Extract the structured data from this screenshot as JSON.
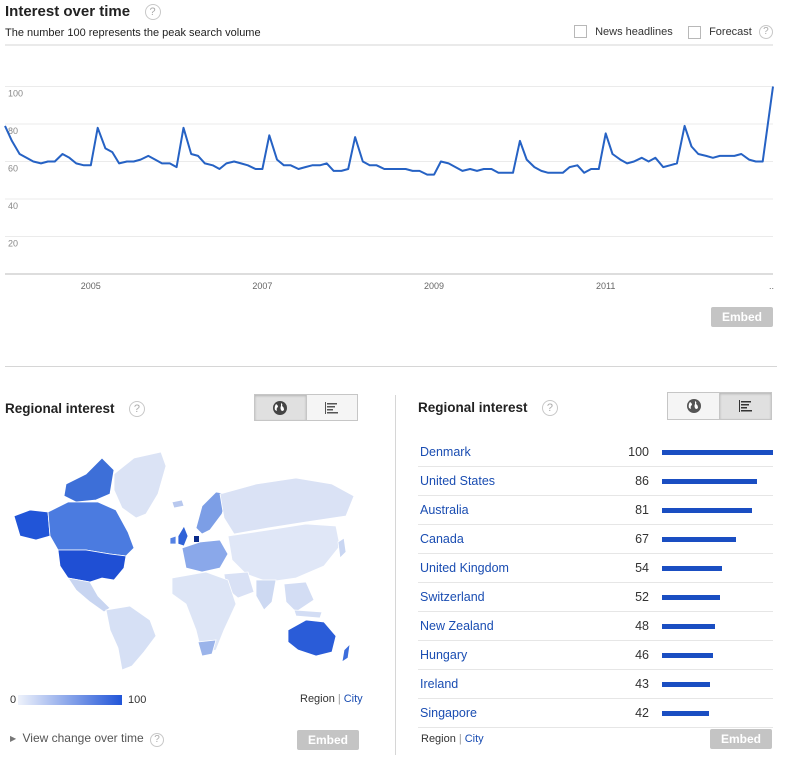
{
  "interest": {
    "title": "Interest over time",
    "subtitle": "The number 100 represents the peak search volume",
    "news_label": "News headlines",
    "forecast_label": "Forecast",
    "help": "?",
    "embed": "Embed"
  },
  "chart_data": {
    "type": "line",
    "title": "Interest over time",
    "y_ticks": [
      "100",
      "80",
      "60",
      "40",
      "20"
    ],
    "x_ticks": [
      "2005",
      "2007",
      "2009",
      "2011"
    ],
    "ellipsis": "..",
    "ylim": [
      0,
      100
    ],
    "xlim": [
      2004.0,
      2012.95
    ],
    "grid": true,
    "color": "#2662c4",
    "series": [
      {
        "values": [
          [
            2004.0,
            79
          ],
          [
            2004.08,
            71
          ],
          [
            2004.17,
            64
          ],
          [
            2004.25,
            62
          ],
          [
            2004.33,
            60
          ],
          [
            2004.42,
            59
          ],
          [
            2004.5,
            60
          ],
          [
            2004.58,
            60
          ],
          [
            2004.67,
            64
          ],
          [
            2004.75,
            62
          ],
          [
            2004.83,
            59
          ],
          [
            2004.92,
            58
          ],
          [
            2005.0,
            58
          ],
          [
            2005.08,
            78
          ],
          [
            2005.17,
            67
          ],
          [
            2005.25,
            65
          ],
          [
            2005.33,
            59
          ],
          [
            2005.42,
            60
          ],
          [
            2005.5,
            60
          ],
          [
            2005.58,
            61
          ],
          [
            2005.67,
            63
          ],
          [
            2005.75,
            61
          ],
          [
            2005.83,
            59
          ],
          [
            2005.92,
            59
          ],
          [
            2006.0,
            57
          ],
          [
            2006.08,
            78
          ],
          [
            2006.17,
            64
          ],
          [
            2006.25,
            63
          ],
          [
            2006.33,
            59
          ],
          [
            2006.42,
            58
          ],
          [
            2006.5,
            56
          ],
          [
            2006.58,
            59
          ],
          [
            2006.67,
            60
          ],
          [
            2006.75,
            59
          ],
          [
            2006.83,
            58
          ],
          [
            2006.92,
            56
          ],
          [
            2007.0,
            56
          ],
          [
            2007.08,
            74
          ],
          [
            2007.17,
            61
          ],
          [
            2007.25,
            58
          ],
          [
            2007.33,
            58
          ],
          [
            2007.42,
            56
          ],
          [
            2007.5,
            57
          ],
          [
            2007.58,
            58
          ],
          [
            2007.67,
            58
          ],
          [
            2007.75,
            59
          ],
          [
            2007.83,
            55
          ],
          [
            2007.92,
            55
          ],
          [
            2008.0,
            56
          ],
          [
            2008.08,
            73
          ],
          [
            2008.17,
            60
          ],
          [
            2008.25,
            58
          ],
          [
            2008.33,
            58
          ],
          [
            2008.42,
            56
          ],
          [
            2008.5,
            56
          ],
          [
            2008.58,
            56
          ],
          [
            2008.67,
            56
          ],
          [
            2008.75,
            55
          ],
          [
            2008.83,
            55
          ],
          [
            2008.92,
            53
          ],
          [
            2009.0,
            53
          ],
          [
            2009.08,
            60
          ],
          [
            2009.17,
            59
          ],
          [
            2009.25,
            57
          ],
          [
            2009.33,
            55
          ],
          [
            2009.42,
            56
          ],
          [
            2009.5,
            55
          ],
          [
            2009.58,
            56
          ],
          [
            2009.67,
            56
          ],
          [
            2009.75,
            54
          ],
          [
            2009.83,
            54
          ],
          [
            2009.92,
            54
          ],
          [
            2010.0,
            71
          ],
          [
            2010.08,
            61
          ],
          [
            2010.17,
            57
          ],
          [
            2010.25,
            55
          ],
          [
            2010.33,
            54
          ],
          [
            2010.42,
            54
          ],
          [
            2010.5,
            54
          ],
          [
            2010.58,
            57
          ],
          [
            2010.67,
            58
          ],
          [
            2010.75,
            54
          ],
          [
            2010.83,
            56
          ],
          [
            2010.92,
            56
          ],
          [
            2011.0,
            75
          ],
          [
            2011.08,
            64
          ],
          [
            2011.17,
            61
          ],
          [
            2011.25,
            59
          ],
          [
            2011.33,
            60
          ],
          [
            2011.42,
            62
          ],
          [
            2011.5,
            60
          ],
          [
            2011.58,
            62
          ],
          [
            2011.67,
            57
          ],
          [
            2011.75,
            58
          ],
          [
            2011.83,
            59
          ],
          [
            2011.92,
            79
          ],
          [
            2012.0,
            68
          ],
          [
            2012.08,
            64
          ],
          [
            2012.17,
            63
          ],
          [
            2012.25,
            62
          ],
          [
            2012.33,
            63
          ],
          [
            2012.42,
            63
          ],
          [
            2012.5,
            63
          ],
          [
            2012.58,
            64
          ],
          [
            2012.67,
            61
          ],
          [
            2012.75,
            60
          ],
          [
            2012.83,
            60
          ],
          [
            2012.95,
            100
          ]
        ]
      }
    ]
  },
  "regional_left": {
    "title": "Regional interest",
    "help": "?",
    "legend_min": "0",
    "legend_max": "100",
    "region_label": "Region",
    "city_label": "City",
    "view_change": "View change over time",
    "embed": "Embed",
    "colors": {
      "low": "#e4eaf8",
      "high": "#2155d8"
    }
  },
  "regional_right": {
    "title": "Regional interest",
    "help": "?",
    "region_label": "Region",
    "city_label": "City",
    "embed": "Embed",
    "rows": [
      {
        "name": "Denmark",
        "value": "100",
        "pct": 100
      },
      {
        "name": "United States",
        "value": "86",
        "pct": 86
      },
      {
        "name": "Australia",
        "value": "81",
        "pct": 81
      },
      {
        "name": "Canada",
        "value": "67",
        "pct": 67
      },
      {
        "name": "United Kingdom",
        "value": "54",
        "pct": 54
      },
      {
        "name": "Switzerland",
        "value": "52",
        "pct": 52
      },
      {
        "name": "New Zealand",
        "value": "48",
        "pct": 48
      },
      {
        "name": "Hungary",
        "value": "46",
        "pct": 46
      },
      {
        "name": "Ireland",
        "value": "43",
        "pct": 43
      },
      {
        "name": "Singapore",
        "value": "42",
        "pct": 42
      }
    ]
  }
}
